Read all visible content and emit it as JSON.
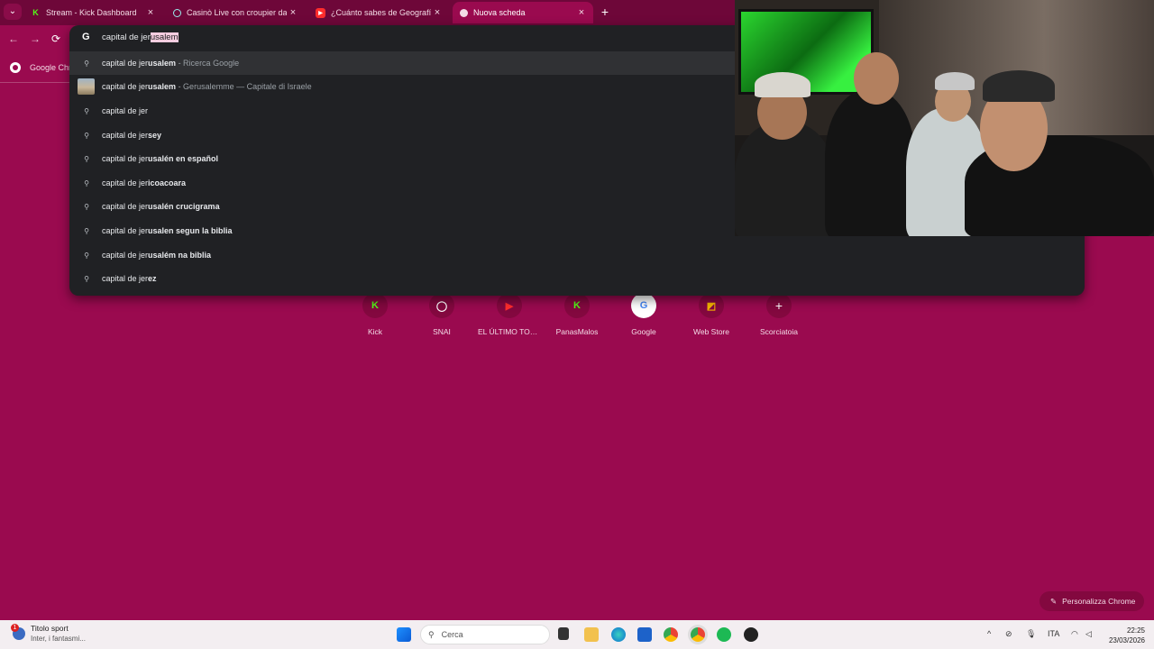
{
  "tabs": [
    {
      "title": "Stream - Kick Dashboard",
      "favicon": "kick-icon",
      "close": "×",
      "active": false
    },
    {
      "title": "Casinò Live con croupier dal vivo",
      "favicon": "snai-icon",
      "close": "×",
      "active": false
    },
    {
      "title": "¿Cuánto sabes de Geografía? 🌎",
      "favicon": "youtube-icon",
      "close": "×",
      "active": false
    },
    {
      "title": "Nuova scheda",
      "favicon": "chrome-newtab-icon",
      "close": "×",
      "active": true
    }
  ],
  "tabstrip": {
    "search_glyph": "⌄",
    "new_tab": "+"
  },
  "toolbar": {
    "back": "←",
    "forward": "→",
    "reload": "⟳"
  },
  "bookmarks": {
    "item": "Google Chrome"
  },
  "omnibox": {
    "typed": "capital de jer",
    "autocomplete": "usalem",
    "engine_icon": "G",
    "suggestions": [
      {
        "prefix": "capital de jer",
        "bold": "usalem",
        "desc": " - Ricerca Google",
        "icon": "search-icon",
        "highlighted": true
      },
      {
        "prefix": "capital de jer",
        "bold": "usalem",
        "desc": " - Gerusalemme — Capitale di Israele",
        "icon": "entity-thumbnail",
        "highlighted": false
      },
      {
        "prefix": "capital de jer",
        "bold": "",
        "desc": "",
        "icon": "search-icon",
        "highlighted": false
      },
      {
        "prefix": "capital de jer",
        "bold": "sey",
        "desc": "",
        "icon": "search-icon",
        "highlighted": false
      },
      {
        "prefix": "capital de jer",
        "bold": "usalén en español",
        "desc": "",
        "icon": "search-icon",
        "highlighted": false
      },
      {
        "prefix": "capital de jer",
        "bold": "icoacoara",
        "desc": "",
        "icon": "search-icon",
        "highlighted": false
      },
      {
        "prefix": "capital de jer",
        "bold": "usalén crucigrama",
        "desc": "",
        "icon": "search-icon",
        "highlighted": false
      },
      {
        "prefix": "capital de jer",
        "bold": "usalen segun la biblia",
        "desc": "",
        "icon": "search-icon",
        "highlighted": false
      },
      {
        "prefix": "capital de jer",
        "bold": "usalém na biblia",
        "desc": "",
        "icon": "search-icon",
        "highlighted": false
      },
      {
        "prefix": "capital de jer",
        "bold": "ez",
        "desc": "",
        "icon": "search-icon",
        "highlighted": false
      }
    ]
  },
  "shortcuts": [
    {
      "label": "Kick",
      "glyph": "K",
      "color": "#53fc18"
    },
    {
      "label": "SNAI",
      "glyph": "◯",
      "color": "#ffffff"
    },
    {
      "label": "EL ÚLTIMO TOU...",
      "glyph": "▶",
      "color": "#ff2d2d"
    },
    {
      "label": "PanasMalos",
      "glyph": "K",
      "color": "#53fc18"
    },
    {
      "label": "Google",
      "glyph": "G",
      "color": "#4285f4"
    },
    {
      "label": "Web Store",
      "glyph": "◩",
      "color": "#f4b400"
    },
    {
      "label": "Scorciatoia",
      "glyph": "+",
      "color": "#ffffff"
    }
  ],
  "customize": {
    "label": "Personalizza Chrome",
    "icon": "✎"
  },
  "taskbar": {
    "weather_title": "Titolo sport",
    "weather_sub": "Inter, i fantasmi...",
    "weather_badge": "1",
    "search_placeholder": "Cerca",
    "lang": "ITA",
    "time": "22:25",
    "date": "23/03/2026"
  },
  "colors": {
    "page_bg": "#9a0a4f",
    "tabstrip_bg": "#6e0739",
    "dropdown_bg": "#202124",
    "highlight": "#303134"
  }
}
